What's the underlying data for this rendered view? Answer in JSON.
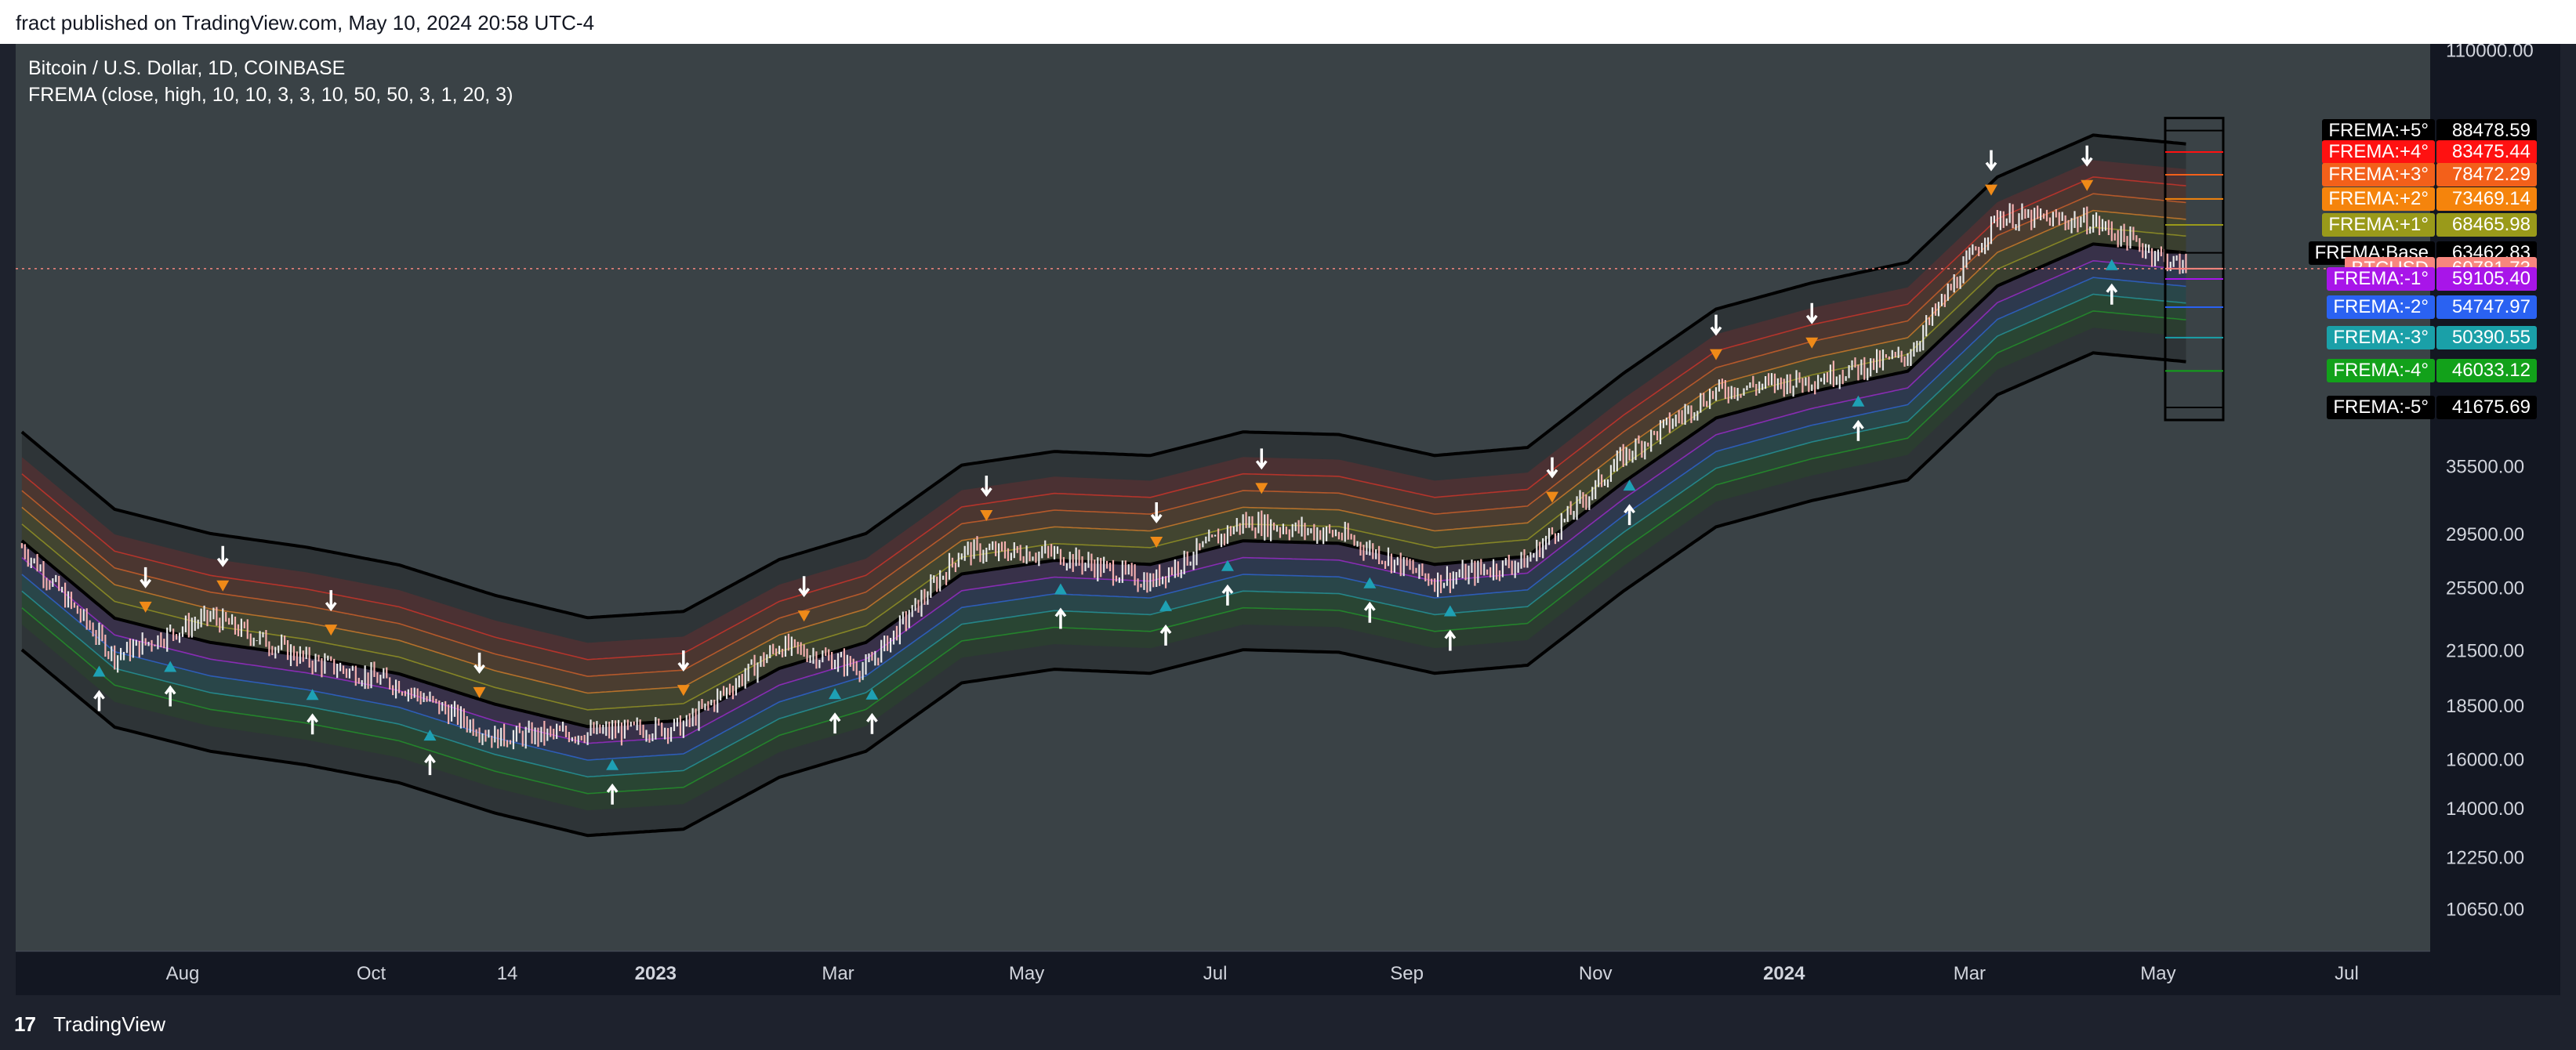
{
  "header": {
    "text": "fract published on TradingView.com, May 10, 2024 20:58 UTC-4"
  },
  "legend": {
    "symbol": "Bitcoin / U.S. Dollar, 1D, COINBASE",
    "indicator": "FREMA (close, high, 10, 10, 3, 3, 10, 50, 50, 3, 1, 20, 3)"
  },
  "footer": {
    "logo": "17",
    "brand": "TradingView"
  },
  "chart_data": {
    "type": "line",
    "title": "Bitcoin / U.S. Dollar, 1D, COINBASE",
    "yscale": "log",
    "ylim": [
      9500,
      112000
    ],
    "y_ticks": [
      "110000.00",
      "35500.00",
      "29500.00",
      "25500.00",
      "21500.00",
      "18500.00",
      "16000.00",
      "14000.00",
      "12250.00",
      "10650.00"
    ],
    "x_ticks": [
      "Aug",
      "Oct",
      "14",
      "2023",
      "Mar",
      "May",
      "Jul",
      "Sep",
      "Nov",
      "2024",
      "Mar",
      "May",
      "Jul"
    ],
    "x_ticks_bold": [
      "2023",
      "2024"
    ],
    "x_dates": [
      "2022-06-10",
      "2022-07-10",
      "2022-08-10",
      "2022-09-10",
      "2022-10-10",
      "2022-11-10",
      "2022-12-10",
      "2023-01-10",
      "2023-02-10",
      "2023-03-10",
      "2023-04-10",
      "2023-05-10",
      "2023-06-10",
      "2023-07-10",
      "2023-08-10",
      "2023-09-10",
      "2023-10-10",
      "2023-11-10",
      "2023-12-10",
      "2024-01-10",
      "2024-02-10",
      "2024-03-10",
      "2024-04-10",
      "2024-05-10"
    ],
    "close": [
      28500,
      21200,
      23600,
      21000,
      19600,
      17000,
      17200,
      17500,
      21800,
      20500,
      28200,
      28000,
      25900,
      30500,
      29500,
      26000,
      27500,
      36500,
      43600,
      45000,
      48000,
      70000,
      69000,
      60781.73
    ],
    "base": [
      29000,
      23500,
      22000,
      21200,
      20200,
      18600,
      17500,
      17800,
      20500,
      22000,
      26500,
      27500,
      27200,
      29000,
      28800,
      27200,
      27800,
      34000,
      40500,
      43500,
      46000,
      58000,
      65000,
      63462.83
    ],
    "band_ratio": 1.0466,
    "bands": [
      {
        "name": "FREMA:+5°",
        "value": "88478.59",
        "color": "#000000"
      },
      {
        "name": "FREMA:+4°",
        "value": "83475.44",
        "color": "#ff1111"
      },
      {
        "name": "FREMA:+3°",
        "value": "78472.29",
        "color": "#f3601a"
      },
      {
        "name": "FREMA:+2°",
        "value": "73469.14",
        "color": "#f5840c"
      },
      {
        "name": "FREMA:+1°",
        "value": "68465.98",
        "color": "#9a9a1a"
      },
      {
        "name": "FREMA:Base",
        "value": "63462.83",
        "color": "#000000"
      },
      {
        "name": "BTCUSD",
        "value": "60781.73",
        "color": "#f7867e"
      },
      {
        "name": "FREMA:-1°",
        "value": "59105.40",
        "color": "#a815e9"
      },
      {
        "name": "FREMA:-2°",
        "value": "54747.97",
        "color": "#2a62f2"
      },
      {
        "name": "FREMA:-3°",
        "value": "50390.55",
        "color": "#1aa0a8"
      },
      {
        "name": "FREMA:-4°",
        "value": "46033.12",
        "color": "#12a11a"
      },
      {
        "name": "FREMA:-5°",
        "value": "41675.69",
        "color": "#000000"
      }
    ],
    "plot_levels": [
      88478.59,
      83475.44,
      78472.29,
      73469.14,
      68465.98,
      63462.83,
      60781.73,
      59105.4,
      54747.97,
      50390.55,
      46033.12,
      41675.69
    ],
    "sell_signals": [
      "2022-07-20",
      "2022-08-14",
      "2022-09-18",
      "2022-11-05",
      "2023-01-10",
      "2023-02-18",
      "2023-04-18",
      "2023-06-12",
      "2023-07-16",
      "2023-10-18",
      "2023-12-10",
      "2024-01-10",
      "2024-03-08",
      "2024-04-08"
    ],
    "buy_signals": [
      "2022-07-05",
      "2022-07-28",
      "2022-09-12",
      "2022-10-20",
      "2022-12-18",
      "2023-02-28",
      "2023-03-12",
      "2023-05-12",
      "2023-06-15",
      "2023-07-05",
      "2023-08-20",
      "2023-09-15",
      "2023-11-12",
      "2024-01-25",
      "2024-04-16"
    ]
  }
}
